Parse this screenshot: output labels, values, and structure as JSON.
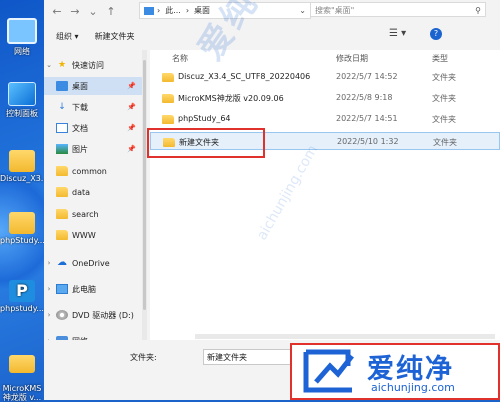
{
  "desktop": {
    "icons": [
      {
        "label": "网络"
      },
      {
        "label": "控制面板"
      },
      {
        "label": "Discuz_X3..."
      },
      {
        "label": "phpStudy..."
      },
      {
        "label": "phpstudy..."
      },
      {
        "label": "MicroKMS\n神龙版 v..."
      }
    ]
  },
  "address_bar": {
    "path_prefix": "此...",
    "path_sep": "›",
    "path_current": "桌面",
    "search_placeholder": "搜索\"桌面\""
  },
  "toolbar": {
    "organize_label": "组织 ▾",
    "new_folder_label": "新建文件夹"
  },
  "nav_pane": {
    "items": [
      {
        "label": "快速访问"
      },
      {
        "label": "桌面"
      },
      {
        "label": "下载"
      },
      {
        "label": "文档"
      },
      {
        "label": "图片"
      },
      {
        "label": "common"
      },
      {
        "label": "data"
      },
      {
        "label": "search"
      },
      {
        "label": "WWW"
      },
      {
        "label": "OneDrive"
      },
      {
        "label": "此电脑"
      },
      {
        "label": "DVD 驱动器 (D:)"
      },
      {
        "label": "网络"
      }
    ]
  },
  "file_list": {
    "columns": {
      "name": "名称",
      "date": "修改日期",
      "type": "类型"
    },
    "rows": [
      {
        "name": "Discuz_X3.4_SC_UTF8_20220406",
        "date": "2022/5/7 14:52",
        "type": "文件夹"
      },
      {
        "name": "MicroKMS神龙版 v20.09.06",
        "date": "2022/5/8 9:18",
        "type": "文件夹"
      },
      {
        "name": "phpStudy_64",
        "date": "2022/5/7 14:51",
        "type": "文件夹"
      },
      {
        "name": "新建文件夹",
        "date": "2022/5/10 1:32",
        "type": "文件夹"
      }
    ]
  },
  "watermark": {
    "text": "爱纯净",
    "url": "aichunjing.com"
  },
  "bottom": {
    "filename_label": "文件夹:",
    "filename_value": "新建文件夹"
  },
  "logo": {
    "text_cn": "爱纯净",
    "url": "aichunjing.com"
  },
  "colors": {
    "accent": "#1d63d6",
    "highlight_red": "#e0312c",
    "selection": "#e5f0fb"
  }
}
